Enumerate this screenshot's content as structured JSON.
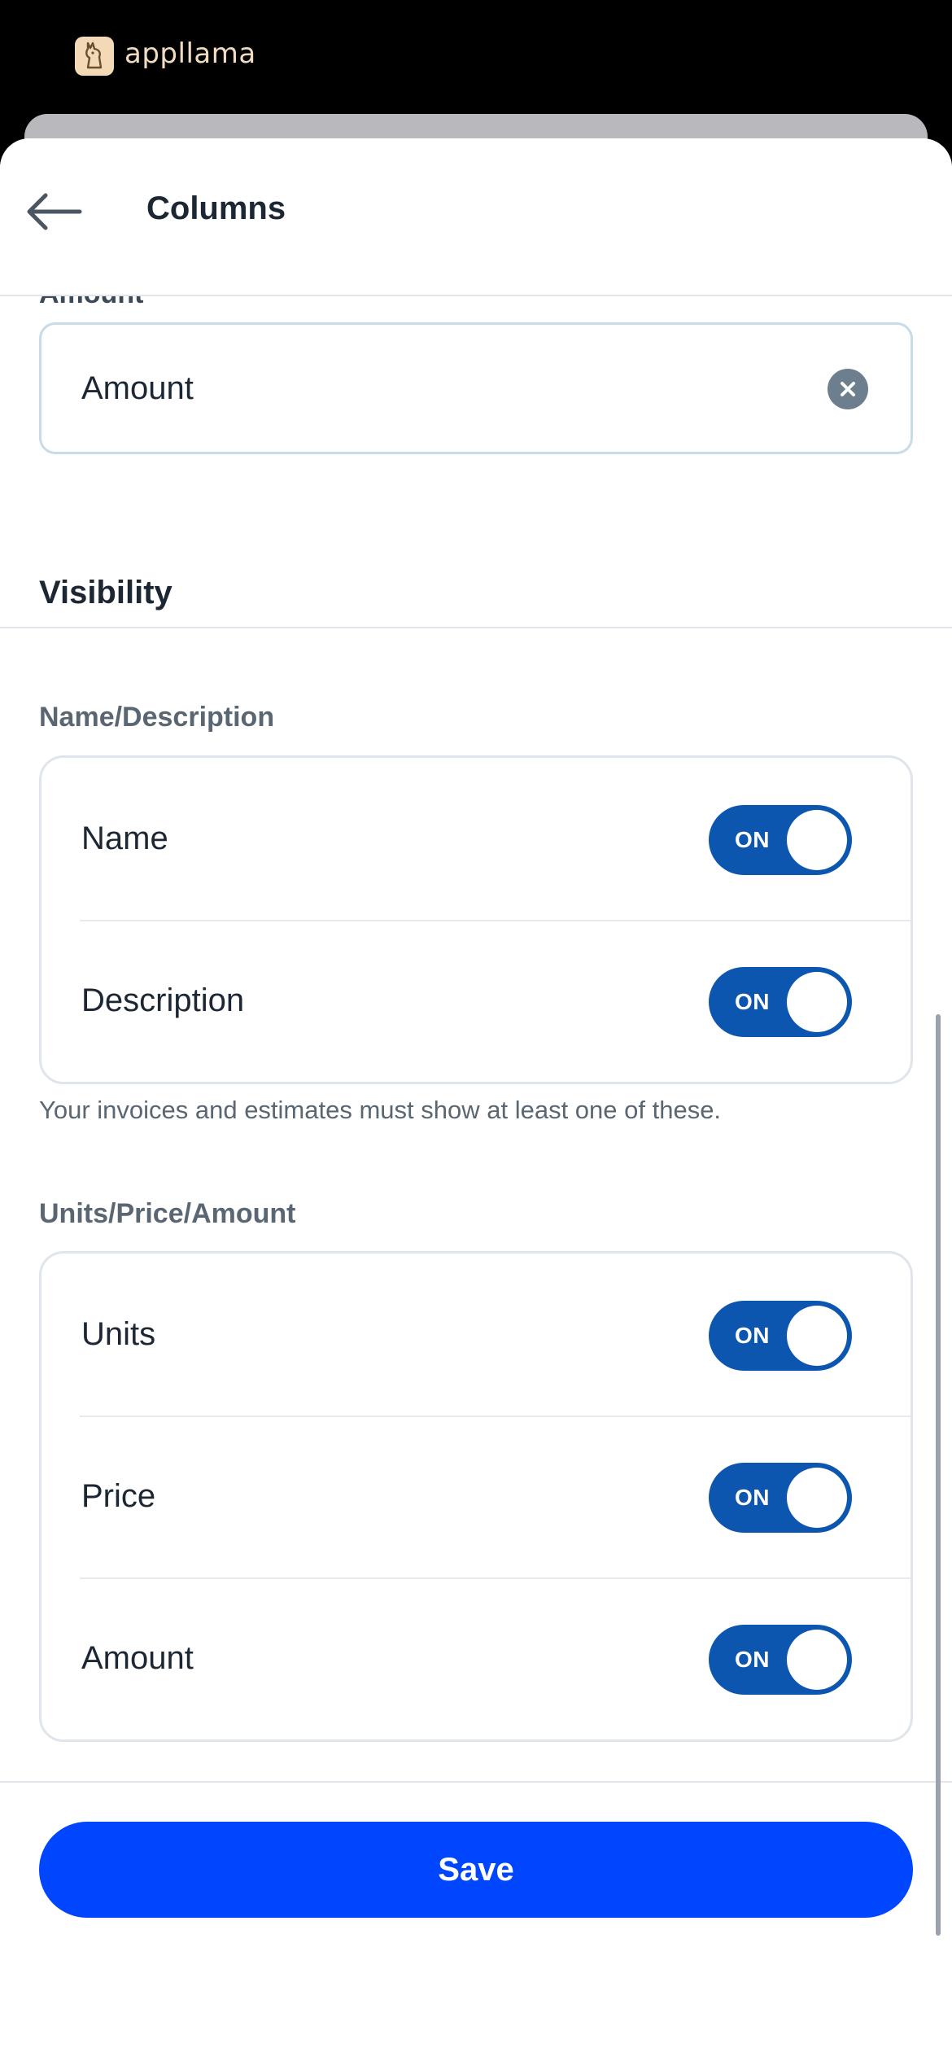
{
  "brand": {
    "name": "appllama",
    "logo_icon": "llama-logo-icon"
  },
  "header": {
    "title": "Columns",
    "back_icon": "arrow-left-icon"
  },
  "amount_field": {
    "label": "Amount",
    "value": "Amount",
    "clear_icon": "clear-circle-icon"
  },
  "visibility": {
    "title": "Visibility",
    "name_description": {
      "label": "Name/Description",
      "rows": [
        {
          "label": "Name",
          "toggle": "ON"
        },
        {
          "label": "Description",
          "toggle": "ON"
        }
      ],
      "helper": "Your invoices and estimates must show at least one of these."
    },
    "units_price_amount": {
      "label": "Units/Price/Amount",
      "rows": [
        {
          "label": "Units",
          "toggle": "ON"
        },
        {
          "label": "Price",
          "toggle": "ON"
        },
        {
          "label": "Amount",
          "toggle": "ON"
        }
      ]
    }
  },
  "footer": {
    "save_label": "Save"
  },
  "colors": {
    "primary_button": "#0046ff",
    "toggle_on": "#0d56b0",
    "text": "#1c2733",
    "muted": "#5a6773",
    "border": "#dfe5ea"
  }
}
